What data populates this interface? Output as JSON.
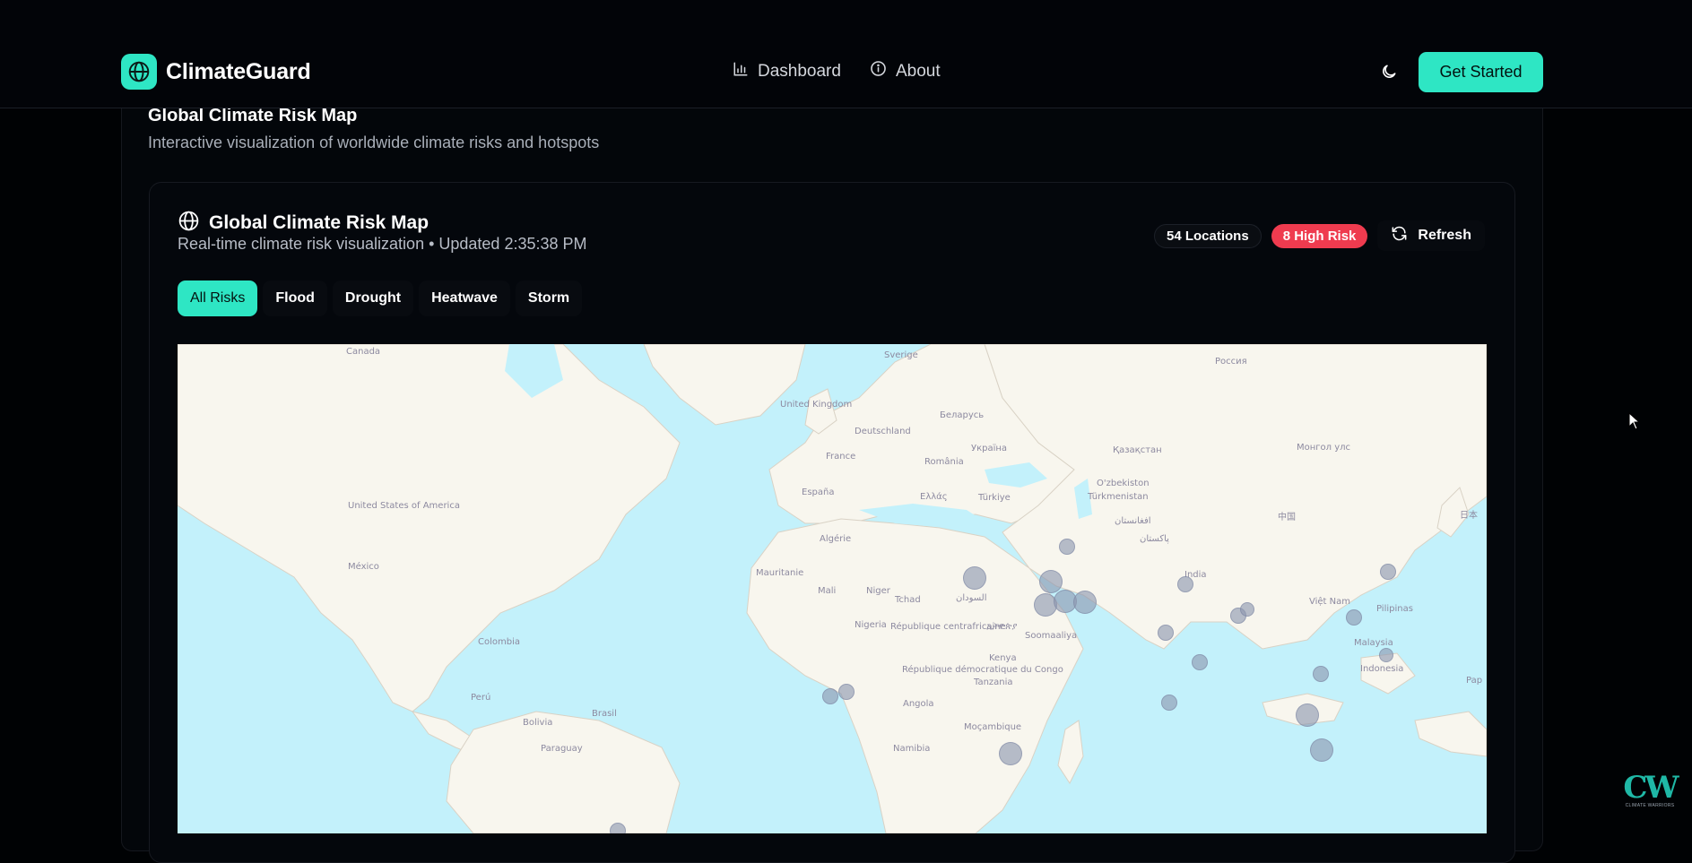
{
  "app": {
    "name": "ClimateGuard",
    "brand_color": "#2ee6c4"
  },
  "nav": {
    "items": [
      {
        "label": "Dashboard",
        "icon": "bar-chart-icon"
      },
      {
        "label": "About",
        "icon": "info-icon"
      }
    ],
    "cta_label": "Get Started",
    "theme_icon": "moon-icon"
  },
  "section": {
    "title": "Global Climate Risk Map",
    "subtitle": "Interactive visualization of worldwide climate risks and hotspots"
  },
  "card": {
    "title": "Global Climate Risk Map",
    "subtitle": "Real-time climate risk visualization • Updated 2:35:38 PM",
    "locations_badge": "54 Locations",
    "high_risk_badge": "8 High Risk",
    "refresh_label": "Refresh",
    "risk_color": "#ef3b4f"
  },
  "filters": [
    "All Risks",
    "Flood",
    "Drought",
    "Heatwave",
    "Storm"
  ],
  "active_filter": "All Risks",
  "map": {
    "labels": [
      "Canada",
      "Sverige",
      "Россия",
      "United Kingdom",
      "Беларусь",
      "Deutschland",
      "France",
      "Україна",
      "Қазақстан",
      "Монгол улс",
      "România",
      "United States of America",
      "España",
      "Ελλάς",
      "Türkiye",
      "O'zbekiston",
      "Türkmenistan",
      "México",
      "Algérie",
      "افغانستان",
      "پاکستان",
      "中国",
      "日本",
      "Mauritanie",
      "Mali",
      "Niger",
      "Tchad",
      "السودان",
      "India",
      "Nigeria",
      "République centrafricaine",
      "ኢትዮጵያ",
      "Soomaaliya",
      "Việt Nam",
      "Pilipinas",
      "Colombia",
      "Kenya",
      "République démocratique du Congo",
      "Malaysia",
      "Indonesia",
      "Tanzania",
      "Perú",
      "Brasil",
      "Angola",
      "Bolivia",
      "Moçambique",
      "Paraguay",
      "Namibia",
      "Pap"
    ]
  },
  "watermark": {
    "mark": "CW",
    "text": "CLIMATE WARRIORS"
  }
}
